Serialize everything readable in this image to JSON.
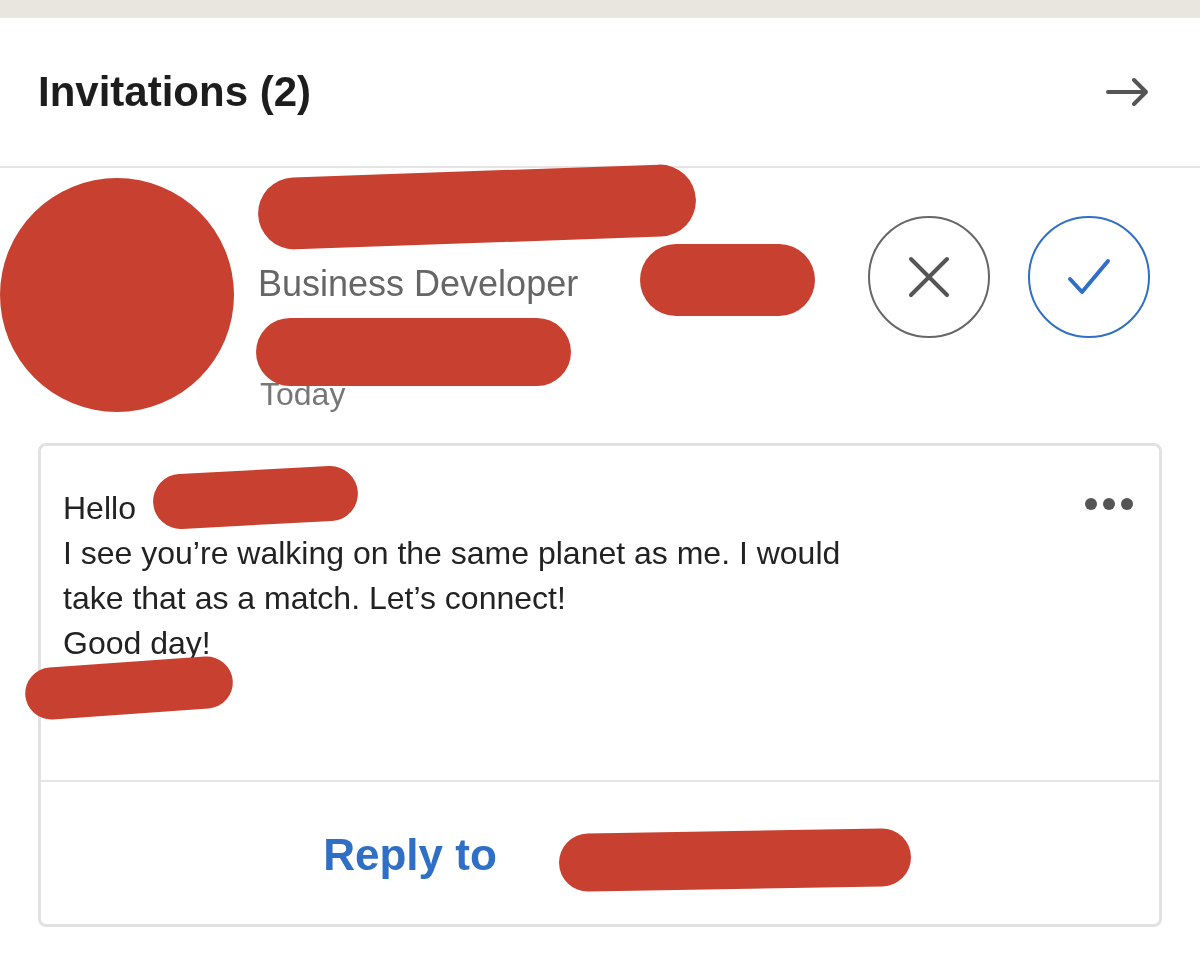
{
  "header": {
    "title": "Invitations (2)"
  },
  "invitation": {
    "name_redacted": true,
    "headline": "Business Developer",
    "headline_redacted": true,
    "subline_redacted": true,
    "time": "Today",
    "actions": [
      {
        "kind": "ignore"
      },
      {
        "kind": "accept"
      }
    ]
  },
  "message": {
    "greeting": "Hello",
    "greeting_redacted": true,
    "lines": [
      "I see you’re walking on the same planet as me. I would",
      "take that as a match. Let’s connect!",
      "Good day!"
    ],
    "signature_redacted": true,
    "reply_label": "Reply to",
    "reply_redacted": true
  }
}
